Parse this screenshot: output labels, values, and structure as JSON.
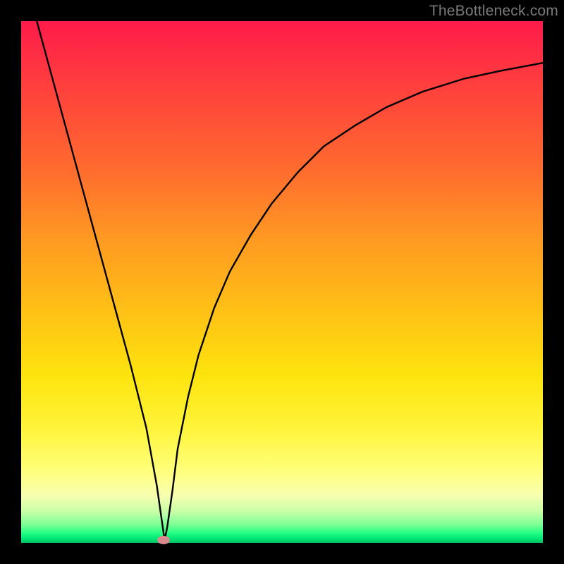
{
  "watermark": "TheBottleneck.com",
  "colors": {
    "top": "#ff1b4a",
    "bottom": "#00c060",
    "curve": "#000000",
    "minpoint": "#d88a8f",
    "frame": "#000000"
  },
  "chart_data": {
    "type": "line",
    "title": "",
    "xlabel": "",
    "ylabel": "",
    "xlim": [
      0,
      100
    ],
    "ylim": [
      0,
      100
    ],
    "grid": false,
    "series": [
      {
        "name": "bottleneck-curve",
        "x": [
          3,
          6,
          9,
          12,
          15,
          18,
          21,
          24,
          26,
          27,
          27.5,
          28,
          29,
          30,
          32,
          34,
          37,
          40,
          44,
          48,
          53,
          58,
          64,
          70,
          77,
          85,
          92,
          100
        ],
        "values": [
          100,
          89,
          78,
          67,
          56,
          45,
          34,
          22,
          11,
          4,
          0.5,
          3,
          10,
          18,
          28,
          36,
          45,
          52,
          59,
          65,
          71,
          76,
          80,
          83.5,
          86.5,
          89,
          90.5,
          92
        ]
      }
    ],
    "annotations": [
      {
        "name": "min-point",
        "x": 27.3,
        "y": 0.5
      }
    ]
  }
}
